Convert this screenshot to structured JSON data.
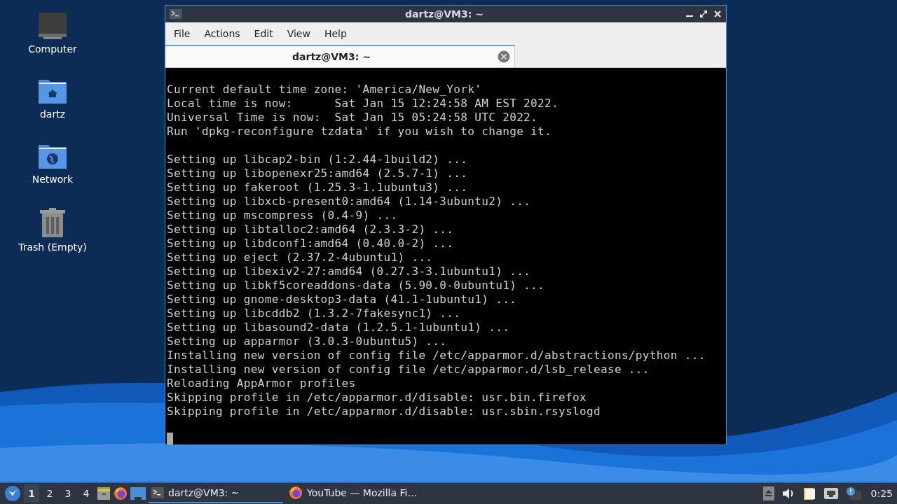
{
  "desktop_icons": [
    {
      "kind": "computer",
      "label": "Computer"
    },
    {
      "kind": "home",
      "label": "dartz"
    },
    {
      "kind": "network",
      "label": "Network"
    },
    {
      "kind": "trash",
      "label": "Trash (Empty)"
    }
  ],
  "window": {
    "title": "dartz@VM3: ~",
    "menu": [
      "File",
      "Actions",
      "Edit",
      "View",
      "Help"
    ],
    "tabs": [
      {
        "label": "dartz@VM3: ~",
        "selected": true
      }
    ],
    "blocks": [
      [
        "Current default time zone: 'America/New_York'",
        "Local time is now:      Sat Jan 15 12:24:58 AM EST 2022.",
        "Universal Time is now:  Sat Jan 15 05:24:58 UTC 2022.",
        "Run 'dpkg-reconfigure tzdata' if you wish to change it."
      ],
      [
        "Setting up libcap2-bin (1:2.44-1build2) ...",
        "Setting up libopenexr25:amd64 (2.5.7-1) ...",
        "Setting up fakeroot (1.25.3-1.1ubuntu3) ...",
        "Setting up libxcb-present0:amd64 (1.14-3ubuntu2) ...",
        "Setting up mscompress (0.4-9) ...",
        "Setting up libtalloc2:amd64 (2.3.3-2) ...",
        "Setting up libdconf1:amd64 (0.40.0-2) ...",
        "Setting up eject (2.37.2-4ubuntu1) ...",
        "Setting up libexiv2-27:amd64 (0.27.3-3.1ubuntu1) ...",
        "Setting up libkf5coreaddons-data (5.90.0-0ubuntu1) ...",
        "Setting up gnome-desktop3-data (41.1-1ubuntu1) ...",
        "Setting up libcddb2 (1.3.2-7fakesync1) ...",
        "Setting up libasound2-data (1.2.5.1-1ubuntu1) ...",
        "Setting up apparmor (3.0.3-0ubuntu5) ...",
        "Installing new version of config file /etc/apparmor.d/abstractions/python ...",
        "Installing new version of config file /etc/apparmor.d/lsb_release ...",
        "Reloading AppArmor profiles",
        "Skipping profile in /etc/apparmor.d/disable: usr.bin.firefox",
        "Skipping profile in /etc/apparmor.d/disable: usr.sbin.rsyslogd"
      ]
    ]
  },
  "taskbar": {
    "workspaces": [
      {
        "label": "1",
        "selected": true
      },
      {
        "label": "2",
        "selected": false
      },
      {
        "label": "3",
        "selected": false
      },
      {
        "label": "4",
        "selected": false
      }
    ],
    "tasks": [
      {
        "kind": "terminal",
        "label": "dartz@VM3: ~",
        "selected": true
      },
      {
        "kind": "firefox",
        "label": "YouTube — Mozilla Fi…",
        "selected": false
      }
    ],
    "clock": "0:25"
  }
}
